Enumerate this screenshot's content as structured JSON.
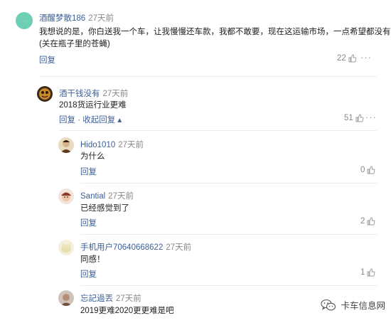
{
  "comments": [
    {
      "user": "酒醒梦散186",
      "time": "27天前",
      "lines": [
        "我想说的是，你白送我一个车，让我慢慢还车款，我都不敢要，现在这运输市场，一点希望都没有！",
        "(关在瓶子里的苍蝇)"
      ],
      "actions": "回复",
      "likes": "22"
    },
    {
      "user": "酒干钱没有",
      "time": "27天前",
      "lines": [
        "2018货运行业更难"
      ],
      "actions": "回复 · 收起回复 ▴",
      "likes": "51"
    },
    {
      "user": "Hido1010",
      "time": "27天前",
      "lines": [
        "为什么"
      ],
      "actions": "回复",
      "likes": "0"
    },
    {
      "user": "Santial",
      "time": "27天前",
      "lines": [
        "已经感觉到了"
      ],
      "actions": "回复",
      "likes": "2"
    },
    {
      "user": "手机用户70640668622",
      "time": "27天前",
      "lines": [
        "同感！"
      ],
      "actions": "回复",
      "likes": "1"
    },
    {
      "user": "忘記過丟",
      "time": "27天前",
      "lines": [
        "2019更难2020更更难是吧"
      ]
    }
  ],
  "watermark": {
    "text": "卡车信息网",
    "icon": "wechat-icon"
  },
  "colors": {
    "link": "#3d5f96",
    "muted": "#888888"
  }
}
